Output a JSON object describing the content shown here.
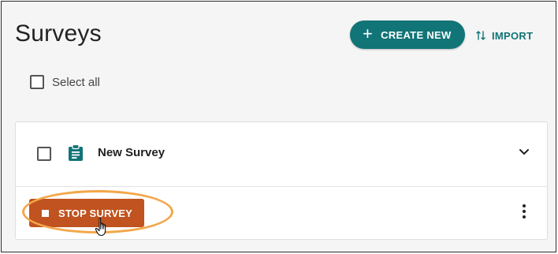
{
  "header": {
    "title": "Surveys",
    "create_label": "CREATE NEW",
    "import_label": "IMPORT"
  },
  "list": {
    "select_all_label": "Select all",
    "items": [
      {
        "name": "New Survey",
        "action_label": "STOP SURVEY"
      }
    ]
  },
  "colors": {
    "primary": "#117477",
    "stop_action": "#c0531f",
    "highlight": "#f2a74b"
  },
  "icons": {
    "create": "plus-icon",
    "import": "swap-vertical-icon",
    "survey": "clipboard-icon",
    "expand": "chevron-down-icon",
    "stop": "stop-square-icon",
    "more": "more-vertical-icon",
    "cursor": "hand-pointer-cursor"
  }
}
